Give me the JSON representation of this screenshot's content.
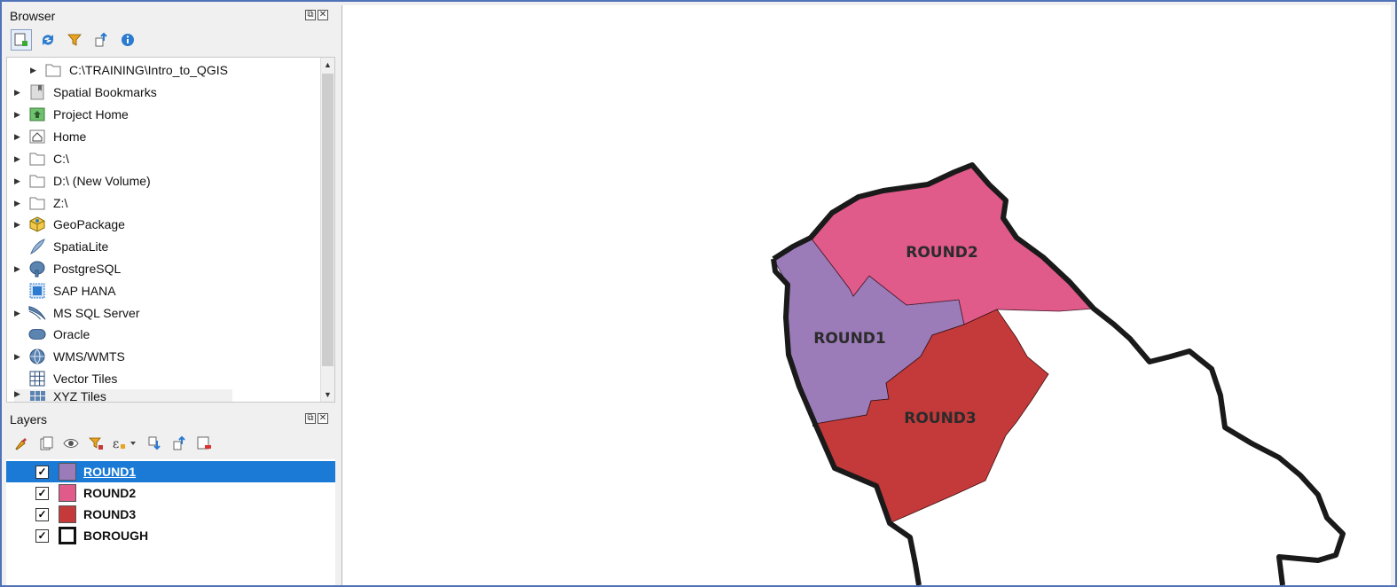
{
  "browser": {
    "title": "Browser",
    "toolbar_icons": [
      "add-layer-icon",
      "refresh-icon",
      "filter-icon",
      "collapse-all-icon",
      "info-icon"
    ],
    "items": [
      {
        "label": "C:\\TRAINING\\Intro_to_QGIS",
        "icon": "folder-icon"
      },
      {
        "label": "Spatial Bookmarks",
        "icon": "bookmark-icon"
      },
      {
        "label": "Project Home",
        "icon": "project-home-icon"
      },
      {
        "label": "Home",
        "icon": "home-icon"
      },
      {
        "label": "C:\\",
        "icon": "folder-icon"
      },
      {
        "label": "D:\\ (New Volume)",
        "icon": "folder-icon"
      },
      {
        "label": "Z:\\",
        "icon": "folder-icon"
      },
      {
        "label": "GeoPackage",
        "icon": "geopackage-icon"
      },
      {
        "label": "SpatiaLite",
        "icon": "spatialite-icon"
      },
      {
        "label": "PostgreSQL",
        "icon": "postgresql-icon"
      },
      {
        "label": "SAP HANA",
        "icon": "sap-hana-icon"
      },
      {
        "label": "MS SQL Server",
        "icon": "mssql-icon"
      },
      {
        "label": "Oracle",
        "icon": "oracle-icon"
      },
      {
        "label": "WMS/WMTS",
        "icon": "wms-icon"
      },
      {
        "label": "Vector Tiles",
        "icon": "vector-tiles-icon"
      },
      {
        "label": "XYZ Tiles",
        "icon": "xyz-tiles-icon"
      }
    ]
  },
  "layers": {
    "title": "Layers",
    "toolbar_icons": [
      "style-icon",
      "add-group-icon",
      "visibility-icon",
      "filter-legend-icon",
      "expression-filter-icon",
      "expand-all-icon",
      "collapse-all-icon",
      "remove-layer-icon"
    ],
    "items": [
      {
        "name": "ROUND1",
        "color": "#9b7bb8",
        "checked": true,
        "selected": true
      },
      {
        "name": "ROUND2",
        "color": "#e05a8a",
        "checked": true,
        "selected": false
      },
      {
        "name": "ROUND3",
        "color": "#c43a3a",
        "checked": true,
        "selected": false
      },
      {
        "name": "BOROUGH",
        "color": "#ffffff",
        "checked": true,
        "selected": false
      }
    ]
  },
  "map": {
    "labels": [
      "ROUND1",
      "ROUND2",
      "ROUND3"
    ],
    "colors": {
      "round1": "#9b7bb8",
      "round2": "#e05a8a",
      "round3": "#c43a3a",
      "borough_outline": "#1a1a1a"
    }
  },
  "dock_buttons": {
    "float": "⧉",
    "close": "✕"
  }
}
